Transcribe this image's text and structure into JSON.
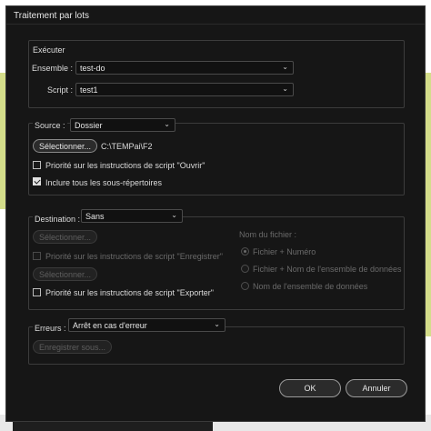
{
  "dialog": {
    "title": "Traitement par lots"
  },
  "execute": {
    "title": "Exécuter",
    "set_label": "Ensemble :",
    "set_value": "test-do",
    "script_label": "Script :",
    "script_value": "test1"
  },
  "source": {
    "label": "Source :",
    "value": "Dossier",
    "choose_button": "Sélectionner...",
    "path": "C:\\TEMPai\\F2",
    "override_open": "Priorité sur les instructions de script \"Ouvrir\"",
    "override_open_checked": false,
    "include_subfolders": "Inclure tous les sous-répertoires",
    "include_subfolders_checked": true
  },
  "destination": {
    "label": "Destination :",
    "value": "Sans",
    "choose_button_1": "Sélectionner...",
    "override_save": "Priorité sur les instructions de script \"Enregistrer\"",
    "choose_button_2": "Sélectionner...",
    "override_export": "Priorité sur les instructions de script \"Exporter\"",
    "override_export_checked": false,
    "file_name_title": "Nom du fichier :",
    "file_name_options": [
      "Fichier + Numéro",
      "Fichier + Nom de l'ensemble de données",
      "Nom de l'ensemble de données"
    ],
    "file_name_selected": 0
  },
  "errors": {
    "label": "Erreurs :",
    "value": "Arrêt en cas d'erreur",
    "save_as_button": "Enregistrer sous..."
  },
  "footer": {
    "ok": "OK",
    "cancel": "Annuler"
  },
  "icons": {
    "chevron": "chevron-down-icon"
  }
}
